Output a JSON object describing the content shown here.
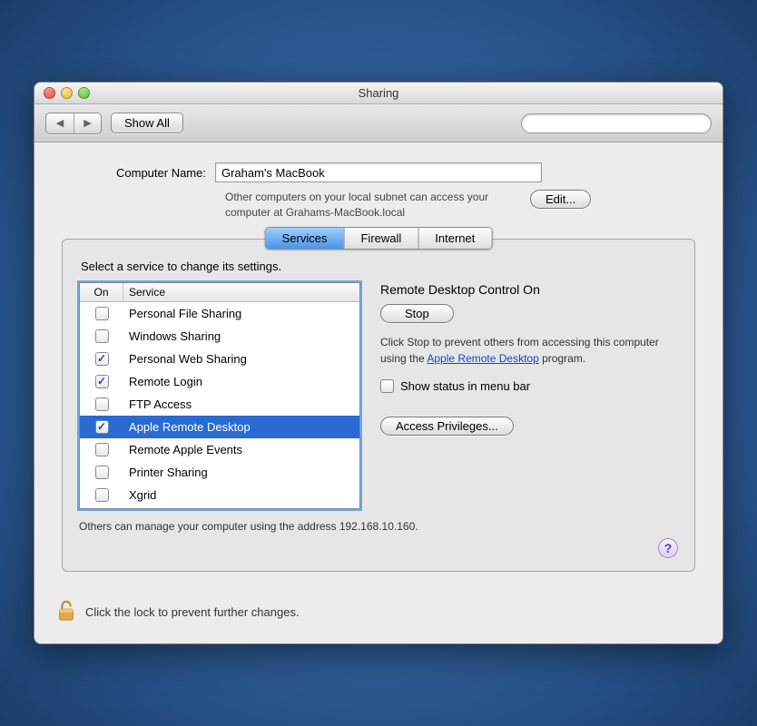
{
  "window": {
    "title": "Sharing"
  },
  "toolbar": {
    "back_icon": "◀",
    "forward_icon": "▶",
    "show_all": "Show All",
    "search_placeholder": ""
  },
  "computer_name": {
    "label": "Computer Name:",
    "value": "Graham's MacBook",
    "hint": "Other computers on your local subnet can access your computer at Grahams-MacBook.local",
    "edit_button": "Edit..."
  },
  "tabs": {
    "services": "Services",
    "firewall": "Firewall",
    "internet": "Internet"
  },
  "services_panel": {
    "instruction": "Select a service to change its settings.",
    "columns": {
      "on": "On",
      "service": "Service"
    },
    "items": [
      {
        "label": "Personal File Sharing",
        "on": false,
        "selected": false
      },
      {
        "label": "Windows Sharing",
        "on": false,
        "selected": false
      },
      {
        "label": "Personal Web Sharing",
        "on": true,
        "selected": false
      },
      {
        "label": "Remote Login",
        "on": true,
        "selected": false
      },
      {
        "label": "FTP Access",
        "on": false,
        "selected": false
      },
      {
        "label": "Apple Remote Desktop",
        "on": true,
        "selected": true
      },
      {
        "label": "Remote Apple Events",
        "on": false,
        "selected": false
      },
      {
        "label": "Printer Sharing",
        "on": false,
        "selected": false
      },
      {
        "label": "Xgrid",
        "on": false,
        "selected": false
      }
    ],
    "detail": {
      "title": "Remote Desktop Control On",
      "stop_button": "Stop",
      "description_pre": "Click Stop to prevent others from accessing this computer using the ",
      "description_link": "Apple Remote Desktop",
      "description_post": " program.",
      "show_status_label": "Show status in menu bar",
      "show_status_checked": false,
      "access_privileges_button": "Access Privileges..."
    },
    "footer": "Others can manage your computer using the address 192.168.10.160."
  },
  "lock": {
    "text": "Click the lock to prevent further changes."
  }
}
